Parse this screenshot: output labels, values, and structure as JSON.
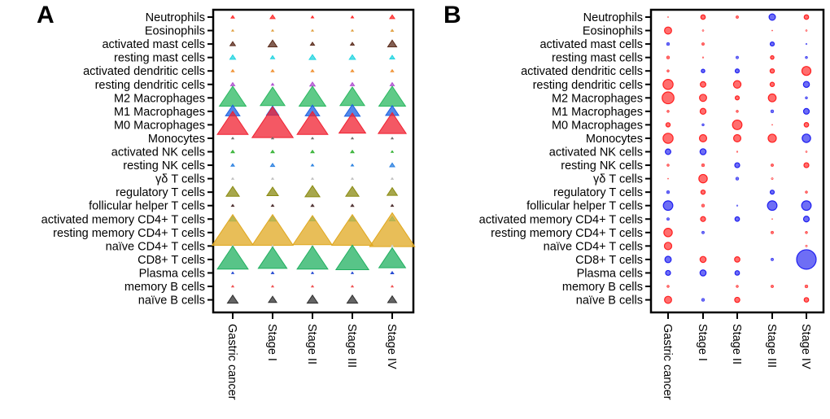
{
  "chart_data": [
    {
      "type": "scatter",
      "panel": "A",
      "marker": "triangle",
      "title": "",
      "xlabel": "",
      "ylabel": "",
      "categories": [
        "Gastric cancer",
        "Stage I",
        "Stage II",
        "Stage III",
        "Stage IV"
      ],
      "rows": [
        "Neutrophils",
        "Eosinophils",
        "activated mast cells",
        "resting mast cells",
        "activated dendritic cells",
        "resting dendritic cells",
        "M2 Macrophages",
        "M1 Macrophages",
        "M0 Macrophages",
        "Monocytes",
        "activated NK cells",
        "resting NK cells",
        "γδ T cells",
        "regulatory T cells",
        "follicular helper T cells",
        "activated memory CD4+ T cells",
        "resting memory CD4+ T cells",
        "naïve CD4+ T cells",
        "CD8+ T cells",
        "Plasma cells",
        "memory B cells",
        "naïve B cells"
      ],
      "row_colors": [
        "#ff2a2a",
        "#e0a040",
        "#5a2a1a",
        "#22d4e0",
        "#f09030",
        "#b050d0",
        "#2ab860",
        "#1a60e0",
        "#f02030",
        "#707070",
        "#30b030",
        "#2a80e0",
        "#c0c0c0",
        "#8a8a10",
        "#4a2a2a",
        "#20d0e0",
        "#e0a820",
        "#d0d0d0",
        "#20b060",
        "#1a40d0",
        "#f05050",
        "#303030"
      ],
      "size_values": [
        [
          0.8,
          1.2,
          0.6,
          0.6,
          1.2
        ],
        [
          0.2,
          0.2,
          0.2,
          0.2,
          0.6
        ],
        [
          1.3,
          2.2,
          1.0,
          0.9,
          2.2
        ],
        [
          1.4,
          1.0,
          1.6,
          1.5,
          1.2
        ],
        [
          0.7,
          0.7,
          0.7,
          0.7,
          0.7
        ],
        [
          1.0,
          0.6,
          1.3,
          1.0,
          1.0
        ],
        [
          6.5,
          6.0,
          6.5,
          6.0,
          6.5
        ],
        [
          3.5,
          3.0,
          3.5,
          3.8,
          3.2
        ],
        [
          7.5,
          10.0,
          7.5,
          6.5,
          6.8
        ],
        [
          0.4,
          0.4,
          0.3,
          0.4,
          0.4
        ],
        [
          0.8,
          0.8,
          0.8,
          0.8,
          0.5
        ],
        [
          0.8,
          1.0,
          0.6,
          0.6,
          1.2
        ],
        [
          0.1,
          0.1,
          0.1,
          0.1,
          0.1
        ],
        [
          3.2,
          2.8,
          3.6,
          3.2,
          2.5
        ],
        [
          0.6,
          0.6,
          0.7,
          0.7,
          0.6
        ],
        [
          1.6,
          1.6,
          1.4,
          1.6,
          1.4
        ],
        [
          10.0,
          10.0,
          9.5,
          10.0,
          11.0
        ],
        [
          0.1,
          0.1,
          0.1,
          0.1,
          0.1
        ],
        [
          7.5,
          7.0,
          7.5,
          8.0,
          6.5
        ],
        [
          0.5,
          0.6,
          0.4,
          0.4,
          0.7
        ],
        [
          0.5,
          0.4,
          0.5,
          0.5,
          0.4
        ],
        [
          2.6,
          2.0,
          2.6,
          2.6,
          2.2
        ]
      ],
      "panel_label": "A"
    },
    {
      "type": "scatter",
      "panel": "B",
      "marker": "circle",
      "title": "",
      "xlabel": "",
      "ylabel": "",
      "categories": [
        "Gastric cancer",
        "Stage I",
        "Stage II",
        "Stage III",
        "Stage IV"
      ],
      "rows": [
        "Neutrophils",
        "Eosinophils",
        "activated mast cells",
        "resting mast cells",
        "activated dendritic cells",
        "resting dendritic cells",
        "M2 Macrophages",
        "M1 Macrophages",
        "M0 Macrophages",
        "Monocytes",
        "activated NK cells",
        "resting NK cells",
        "γδ T cells",
        "regulatory T cells",
        "follicular helper T cells",
        "activated memory CD4+ T cells",
        "resting memory CD4+ T cells",
        "naïve CD4+ T cells",
        "CD8+ T cells",
        "Plasma cells",
        "memory B cells",
        "naïve B cells"
      ],
      "color_legend": {
        "positive": "#ff2020",
        "negative": "#2020f0"
      },
      "signed_values": [
        [
          0.05,
          1.0,
          0.4,
          -2.0,
          1.0
        ],
        [
          2.5,
          0.15,
          0.0,
          0.05,
          0.15
        ],
        [
          -0.5,
          0.4,
          0.0,
          -0.8,
          -0.1
        ],
        [
          0.5,
          0.1,
          -0.4,
          0.6,
          -0.3
        ],
        [
          0.3,
          -0.6,
          -0.8,
          0.9,
          4.0
        ],
        [
          5.0,
          1.5,
          2.8,
          0.9,
          -1.8
        ],
        [
          7.0,
          2.5,
          0.8,
          3.0,
          -0.3
        ],
        [
          0.3,
          1.7,
          0.3,
          -0.5,
          -1.6
        ],
        [
          0.9,
          -0.3,
          4.5,
          0.05,
          1.0
        ],
        [
          5.0,
          2.6,
          2.6,
          3.3,
          -3.5
        ],
        [
          -1.5,
          -1.8,
          0.1,
          0,
          0.15
        ],
        [
          0.3,
          0.5,
          -1.2,
          0.4,
          1.2
        ],
        [
          0.05,
          3.5,
          -0.5,
          0.2,
          0
        ],
        [
          -0.5,
          0.9,
          0,
          -0.8,
          0.3
        ],
        [
          -4.5,
          0.5,
          -0.1,
          -4.5,
          -4.5
        ],
        [
          -0.4,
          1.2,
          -1.0,
          0.05,
          -1.6
        ],
        [
          3.5,
          -0.4,
          0,
          0.4,
          0.3
        ],
        [
          2.7,
          0,
          0,
          0,
          0.2
        ],
        [
          -2.0,
          1.8,
          1.4,
          -0.4,
          -19.0
        ],
        [
          -1.2,
          -1.8,
          -1.0,
          0,
          0
        ],
        [
          0.3,
          0,
          0.3,
          0.4,
          0.5
        ],
        [
          2.5,
          -0.5,
          1.3,
          0,
          1.0
        ]
      ],
      "panel_label": "B"
    }
  ]
}
